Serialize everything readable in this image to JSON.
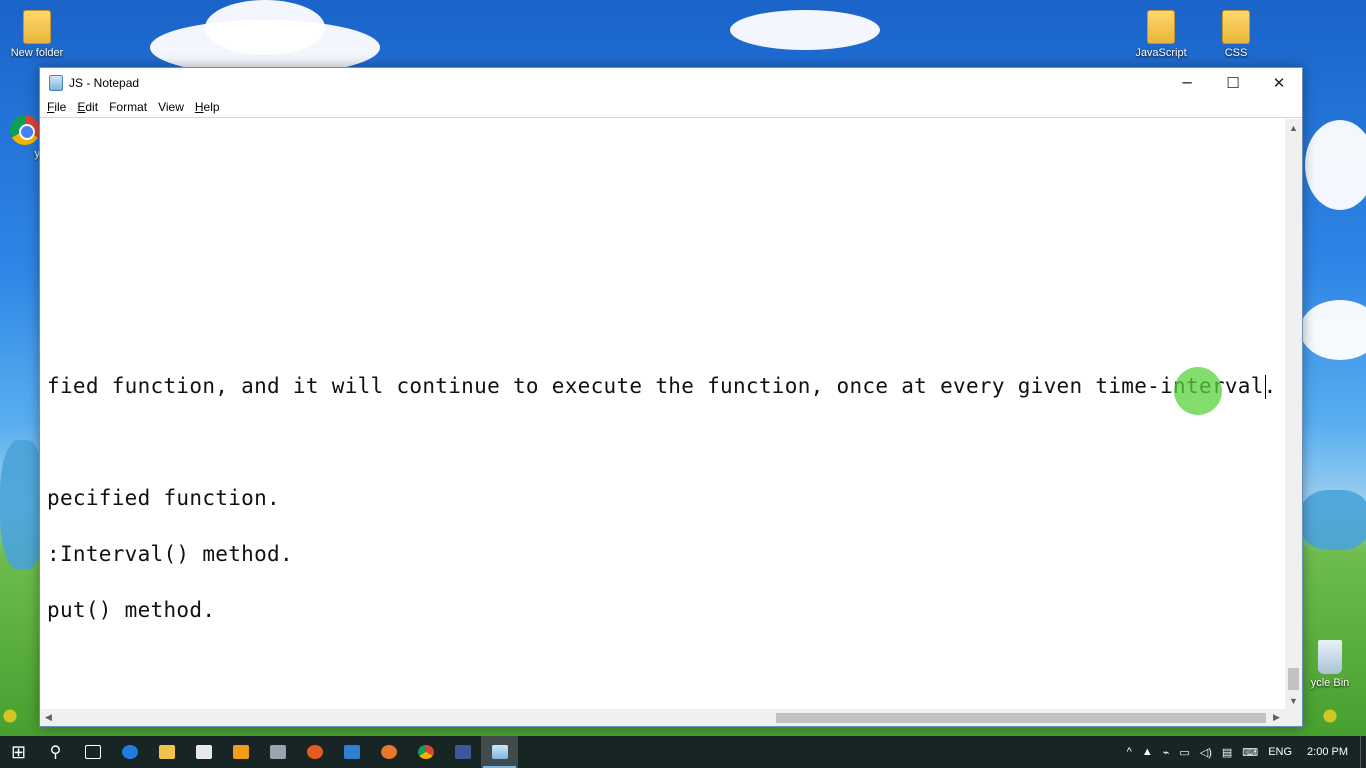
{
  "desktop": {
    "icons": [
      {
        "label": "New folder"
      },
      {
        "label": "JavaScript"
      },
      {
        "label": "CSS"
      },
      {
        "label": "y"
      },
      {
        "label": "ycle Bin"
      }
    ]
  },
  "window": {
    "title": "JS - Notepad",
    "controls": {
      "minimize": "─",
      "maximize": "☐",
      "close": "✕"
    },
    "menu": [
      {
        "accel": "F",
        "rest": "ile"
      },
      {
        "accel": "E",
        "rest": "dit"
      },
      {
        "accel": "",
        "rest": "Format"
      },
      {
        "accel": "",
        "rest": "View"
      },
      {
        "accel": "H",
        "rest": "elp"
      }
    ],
    "editor_lines": [
      "fied function, and it will continue to execute the function, once at every given time-interval.",
      "pecified function.",
      ":Interval() method.",
      "put() method."
    ]
  },
  "taskbar": {
    "start": "⊞",
    "search": "⚲",
    "tray": {
      "chevron": "^",
      "language": "ENG",
      "time": "2:00 PM"
    }
  },
  "colors": {
    "taskbar": "#141c24",
    "cursor_highlight": "#5ad23c",
    "active_underline": "#7fb6e8"
  }
}
